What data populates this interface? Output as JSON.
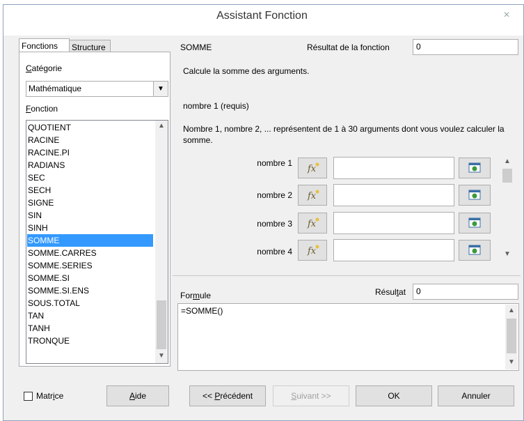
{
  "window": {
    "title": "Assistant Fonction",
    "close": "×"
  },
  "tabs": [
    {
      "label": "Fonctions"
    },
    {
      "label": "Structure"
    }
  ],
  "left": {
    "category_label": "Catégorie",
    "category_value": "Mathématique",
    "function_label": "Fonction",
    "functions": [
      "QUOTIENT",
      "RACINE",
      "RACINE.PI",
      "RADIANS",
      "SEC",
      "SECH",
      "SIGNE",
      "SIN",
      "SINH",
      "SOMME",
      "SOMME.CARRES",
      "SOMME.SERIES",
      "SOMME.SI",
      "SOMME.SI.ENS",
      "SOUS.TOTAL",
      "TAN",
      "TANH",
      "TRONQUE"
    ],
    "selected": "SOMME"
  },
  "right": {
    "func_name": "SOMME",
    "result_label": "Résultat de la fonction",
    "result_value": "0",
    "description": "Calcule la somme des arguments.",
    "arg_heading": "nombre 1 (requis)",
    "arg_description": "Nombre 1, nombre 2, ... représentent de 1 à 30 arguments dont vous voulez calculer la somme.",
    "args": [
      {
        "label": "nombre 1",
        "value": ""
      },
      {
        "label": "nombre 2",
        "value": ""
      },
      {
        "label": "nombre 3",
        "value": ""
      },
      {
        "label": "nombre 4",
        "value": ""
      }
    ],
    "formula_label": "Formule",
    "formula_result_label": "Résultat",
    "formula_result_value": "0",
    "formula_text": "=SOMME()"
  },
  "footer": {
    "matrix_label": "Matrice",
    "help": "Aide",
    "prev": "<< Précédent",
    "next": "Suivant >>",
    "ok": "OK",
    "cancel": "Annuler"
  }
}
